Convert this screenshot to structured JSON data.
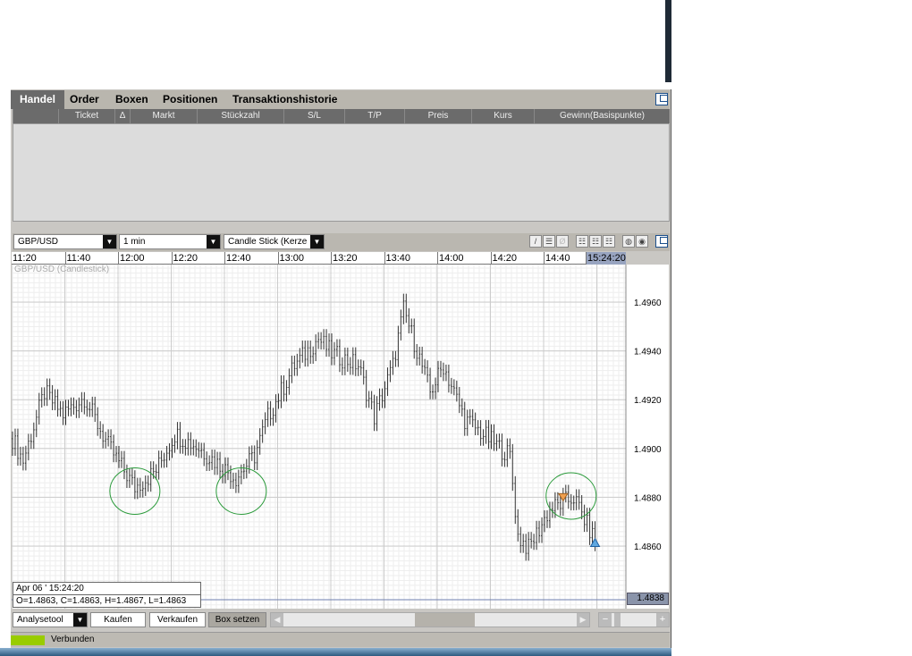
{
  "tabs": [
    {
      "label": "Handel",
      "active": true
    },
    {
      "label": "Order"
    },
    {
      "label": "Boxen"
    },
    {
      "label": "Positionen"
    },
    {
      "label": "Transaktionshistorie"
    }
  ],
  "table": {
    "columns": [
      "",
      "Ticket",
      "∆",
      "Markt",
      "Stückzahl",
      "S/L",
      "T/P",
      "Preis",
      "Kurs",
      "Gewinn(Basispunkte)"
    ]
  },
  "chart_toolbar": {
    "symbol": "GBP/USD",
    "interval": "1 min",
    "chart_type": "Candle Stick (Kerze",
    "icons": [
      "line-tool",
      "horizontal-line-tool",
      "erase-tool",
      "grid-1",
      "grid-2",
      "grid-3",
      "zoom-in",
      "zoom-out",
      "popout"
    ]
  },
  "time_axis": {
    "labels": [
      "11:20",
      "11:40",
      "12:00",
      "12:20",
      "12:40",
      "13:00",
      "13:20",
      "13:40",
      "14:00",
      "14:20",
      "14:40"
    ],
    "current": "15:24:20"
  },
  "chart_data": {
    "type": "candlestick",
    "title": "GBP/USD (Candlestick)",
    "y_ticks": [
      1.496,
      1.494,
      1.492,
      1.49,
      1.488,
      1.486
    ],
    "ylim": [
      1.4828,
      1.4975
    ],
    "x_start": "11:20",
    "minutes_per_candle": 1,
    "close_path": [
      [
        0,
        1.4904
      ],
      [
        4,
        1.4895
      ],
      [
        12,
        1.4923
      ],
      [
        19,
        1.4914
      ],
      [
        27,
        1.4921
      ],
      [
        36,
        1.4901
      ],
      [
        46,
        1.4884
      ],
      [
        54,
        1.4891
      ],
      [
        61,
        1.4906
      ],
      [
        69,
        1.4901
      ],
      [
        84,
        1.4888
      ],
      [
        91,
        1.4897
      ],
      [
        96,
        1.4913
      ],
      [
        106,
        1.4934
      ],
      [
        115,
        1.4945
      ],
      [
        120,
        1.4939
      ],
      [
        130,
        1.4934
      ],
      [
        136,
        1.4913
      ],
      [
        143,
        1.4934
      ],
      [
        147,
        1.4957
      ],
      [
        153,
        1.4937
      ],
      [
        157,
        1.4923
      ],
      [
        162,
        1.4934
      ],
      [
        170,
        1.4912
      ],
      [
        179,
        1.4904
      ],
      [
        187,
        1.4897
      ],
      [
        190,
        1.4864
      ],
      [
        194,
        1.4859
      ],
      [
        202,
        1.4875
      ],
      [
        211,
        1.488
      ],
      [
        219,
        1.4862
      ]
    ],
    "current_price": "1.4838",
    "annotations": [
      {
        "type": "ellipse",
        "minute": 46,
        "price": 1.4884
      },
      {
        "type": "ellipse",
        "minute": 86,
        "price": 1.4884
      },
      {
        "type": "ellipse",
        "minute": 210,
        "price": 1.4882
      },
      {
        "type": "sell-marker",
        "minute": 207,
        "price": 1.488
      },
      {
        "type": "buy-marker",
        "minute": 219,
        "price": 1.4862
      }
    ]
  },
  "info": {
    "date": "Apr 06 ' 15:24:20",
    "ohlc": "O=1.4863, C=1.4863, H=1.4867, L=1.4863"
  },
  "bottom": {
    "analysis": "Analysetool",
    "buy": "Kaufen",
    "sell": "Verkaufen",
    "box": "Box setzen"
  },
  "status": {
    "label": "Verbunden",
    "color": "#99cc00"
  }
}
